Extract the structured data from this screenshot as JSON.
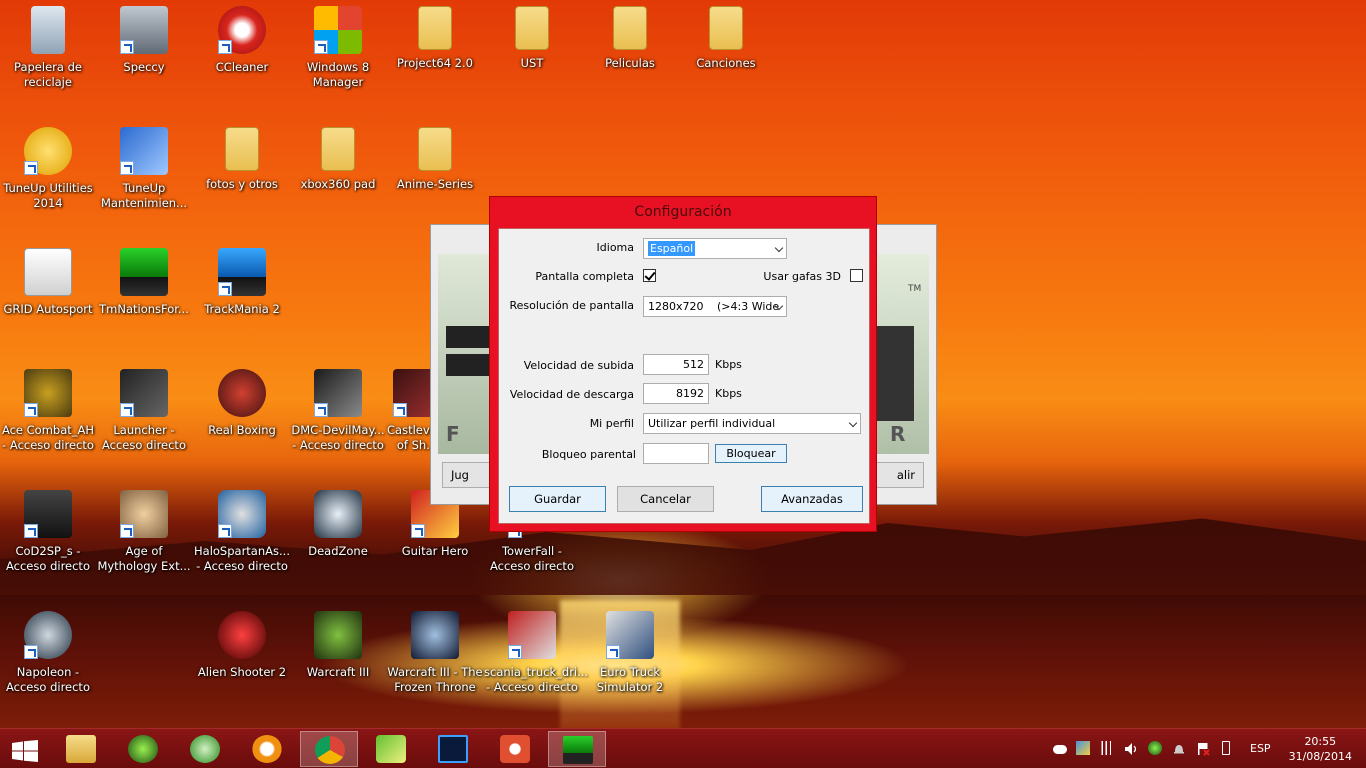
{
  "desktop": {
    "icons": [
      {
        "label": "Papelera de reciclaje",
        "icon": "recycle-bin-icon"
      },
      {
        "label": "Speccy",
        "icon": "speccy-icon"
      },
      {
        "label": "CCleaner",
        "icon": "ccleaner-icon"
      },
      {
        "label": "Windows 8 Manager",
        "icon": "windows8-manager-icon"
      },
      {
        "label": "Project64 2.0",
        "icon": "folder-icon"
      },
      {
        "label": "UST",
        "icon": "folder-icon"
      },
      {
        "label": "Peliculas",
        "icon": "folder-icon"
      },
      {
        "label": "Canciones",
        "icon": "folder-icon"
      },
      {
        "label": "TuneUp Utilities 2014",
        "icon": "tuneup-icon"
      },
      {
        "label": "TuneUp Mantenimien...",
        "icon": "tuneup-maint-icon"
      },
      {
        "label": "fotos y otros",
        "icon": "folder-icon"
      },
      {
        "label": "xbox360 pad",
        "icon": "folder-icon"
      },
      {
        "label": "Anime-Series",
        "icon": "folder-icon"
      },
      {
        "label": "GRID Autosport",
        "icon": "grid-autosport-icon"
      },
      {
        "label": "TmNationsFor...",
        "icon": "tmnations-icon"
      },
      {
        "label": "TrackMania 2",
        "icon": "trackmania-icon"
      },
      {
        "label": "Ace Combat_AH - Acceso directo",
        "icon": "ace-combat-icon"
      },
      {
        "label": "Launcher - Acceso directo",
        "icon": "launcher-icon"
      },
      {
        "label": "Real Boxing",
        "icon": "real-boxing-icon"
      },
      {
        "label": "DMC-DevilMay... - Acceso directo",
        "icon": "dmc-icon"
      },
      {
        "label": "Castleva... of Sh...",
        "icon": "castlevania-icon"
      },
      {
        "label": "CoD2SP_s - Acceso directo",
        "icon": "cod2-icon"
      },
      {
        "label": "Age of Mythology Ext...",
        "icon": "age-of-mythology-icon"
      },
      {
        "label": "HaloSpartanAs... - Acceso directo",
        "icon": "halo-icon"
      },
      {
        "label": "DeadZone",
        "icon": "deadzone-icon"
      },
      {
        "label": "Guitar Hero",
        "icon": "guitar-hero-icon"
      },
      {
        "label": "TowerFall - Acceso directo",
        "icon": "towerfall-icon"
      },
      {
        "label": "Napoleon - Acceso directo",
        "icon": "napoleon-icon"
      },
      {
        "label": "Alien Shooter 2",
        "icon": "alien-shooter-icon"
      },
      {
        "label": "Warcraft III",
        "icon": "warcraft-icon"
      },
      {
        "label": "Warcraft III - The Frozen Throne",
        "icon": "warcraft-ft-icon"
      },
      {
        "label": "scania_truck_dri... - Acceso directo",
        "icon": "scania-icon"
      },
      {
        "label": "Euro Truck Simulator 2",
        "icon": "euro-truck-icon"
      }
    ]
  },
  "background_window": {
    "left_button": "Jug",
    "right_button": "alir",
    "left_letter": "F",
    "right_letter": "R",
    "tm_mark": "TM"
  },
  "dialog": {
    "title": "Configuración",
    "idioma_label": "Idioma",
    "idioma_value": "Español",
    "pantalla_completa_label": "Pantalla completa",
    "gafas_3d_label": "Usar gafas 3D",
    "resolucion_label": "Resolución de pantalla",
    "resolucion_value": "1280x720",
    "resolucion_ratio": "(>4:3 Wide",
    "subida_label": "Velocidad de subida",
    "subida_value": "512",
    "subida_unit": "Kbps",
    "descarga_label": "Velocidad de descarga",
    "descarga_value": "8192",
    "descarga_unit": "Kbps",
    "perfil_label": "Mi perfil",
    "perfil_value": "Utilizar perfil individual",
    "bloqueo_label": "Bloqueo parental",
    "bloquear_button": "Bloquear",
    "guardar_button": "Guardar",
    "cancelar_button": "Cancelar",
    "avanzadas_button": "Avanzadas"
  },
  "taskbar": {
    "language": "ESP",
    "time": "20:55",
    "date": "31/08/2014"
  },
  "colors": {
    "dialog_frame": "#e81123",
    "taskbar": "#7a1010",
    "selection": "#3399ff"
  }
}
